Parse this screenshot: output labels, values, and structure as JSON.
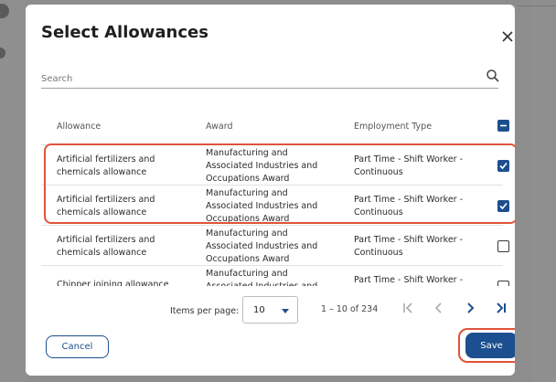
{
  "dialog": {
    "title": "Select Allowances",
    "search_placeholder": "Search"
  },
  "table": {
    "columns": [
      "Allowance",
      "Award",
      "Employment Type"
    ],
    "rows": [
      {
        "allowance": "Artificial fertilizers and chemicals allowance",
        "award": "Manufacturing and Associated Industries and Occupations Award",
        "employment": "Part Time - Shift Worker - Continuous",
        "checked": true
      },
      {
        "allowance": "Artificial fertilizers and chemicals allowance",
        "award": "Manufacturing and Associated Industries and Occupations Award",
        "employment": "Part Time - Shift Worker - Continuous",
        "checked": true
      },
      {
        "allowance": "Artificial fertilizers and chemicals allowance",
        "award": "Manufacturing and Associated Industries and Occupations Award",
        "employment": "Part Time - Shift Worker - Continuous",
        "checked": false
      },
      {
        "allowance": "Chipper joining allowance",
        "award": "Manufacturing and Associated Industries and",
        "employment": "Part Time - Shift Worker -",
        "checked": false
      }
    ]
  },
  "pagination": {
    "items_per_page_label": "Items per page:",
    "items_per_page_value": "10",
    "range": "1 – 10 of 234"
  },
  "buttons": {
    "cancel": "Cancel",
    "save": "Save"
  },
  "colors": {
    "accent": "#1c4f8f",
    "highlight": "#e0533a"
  }
}
